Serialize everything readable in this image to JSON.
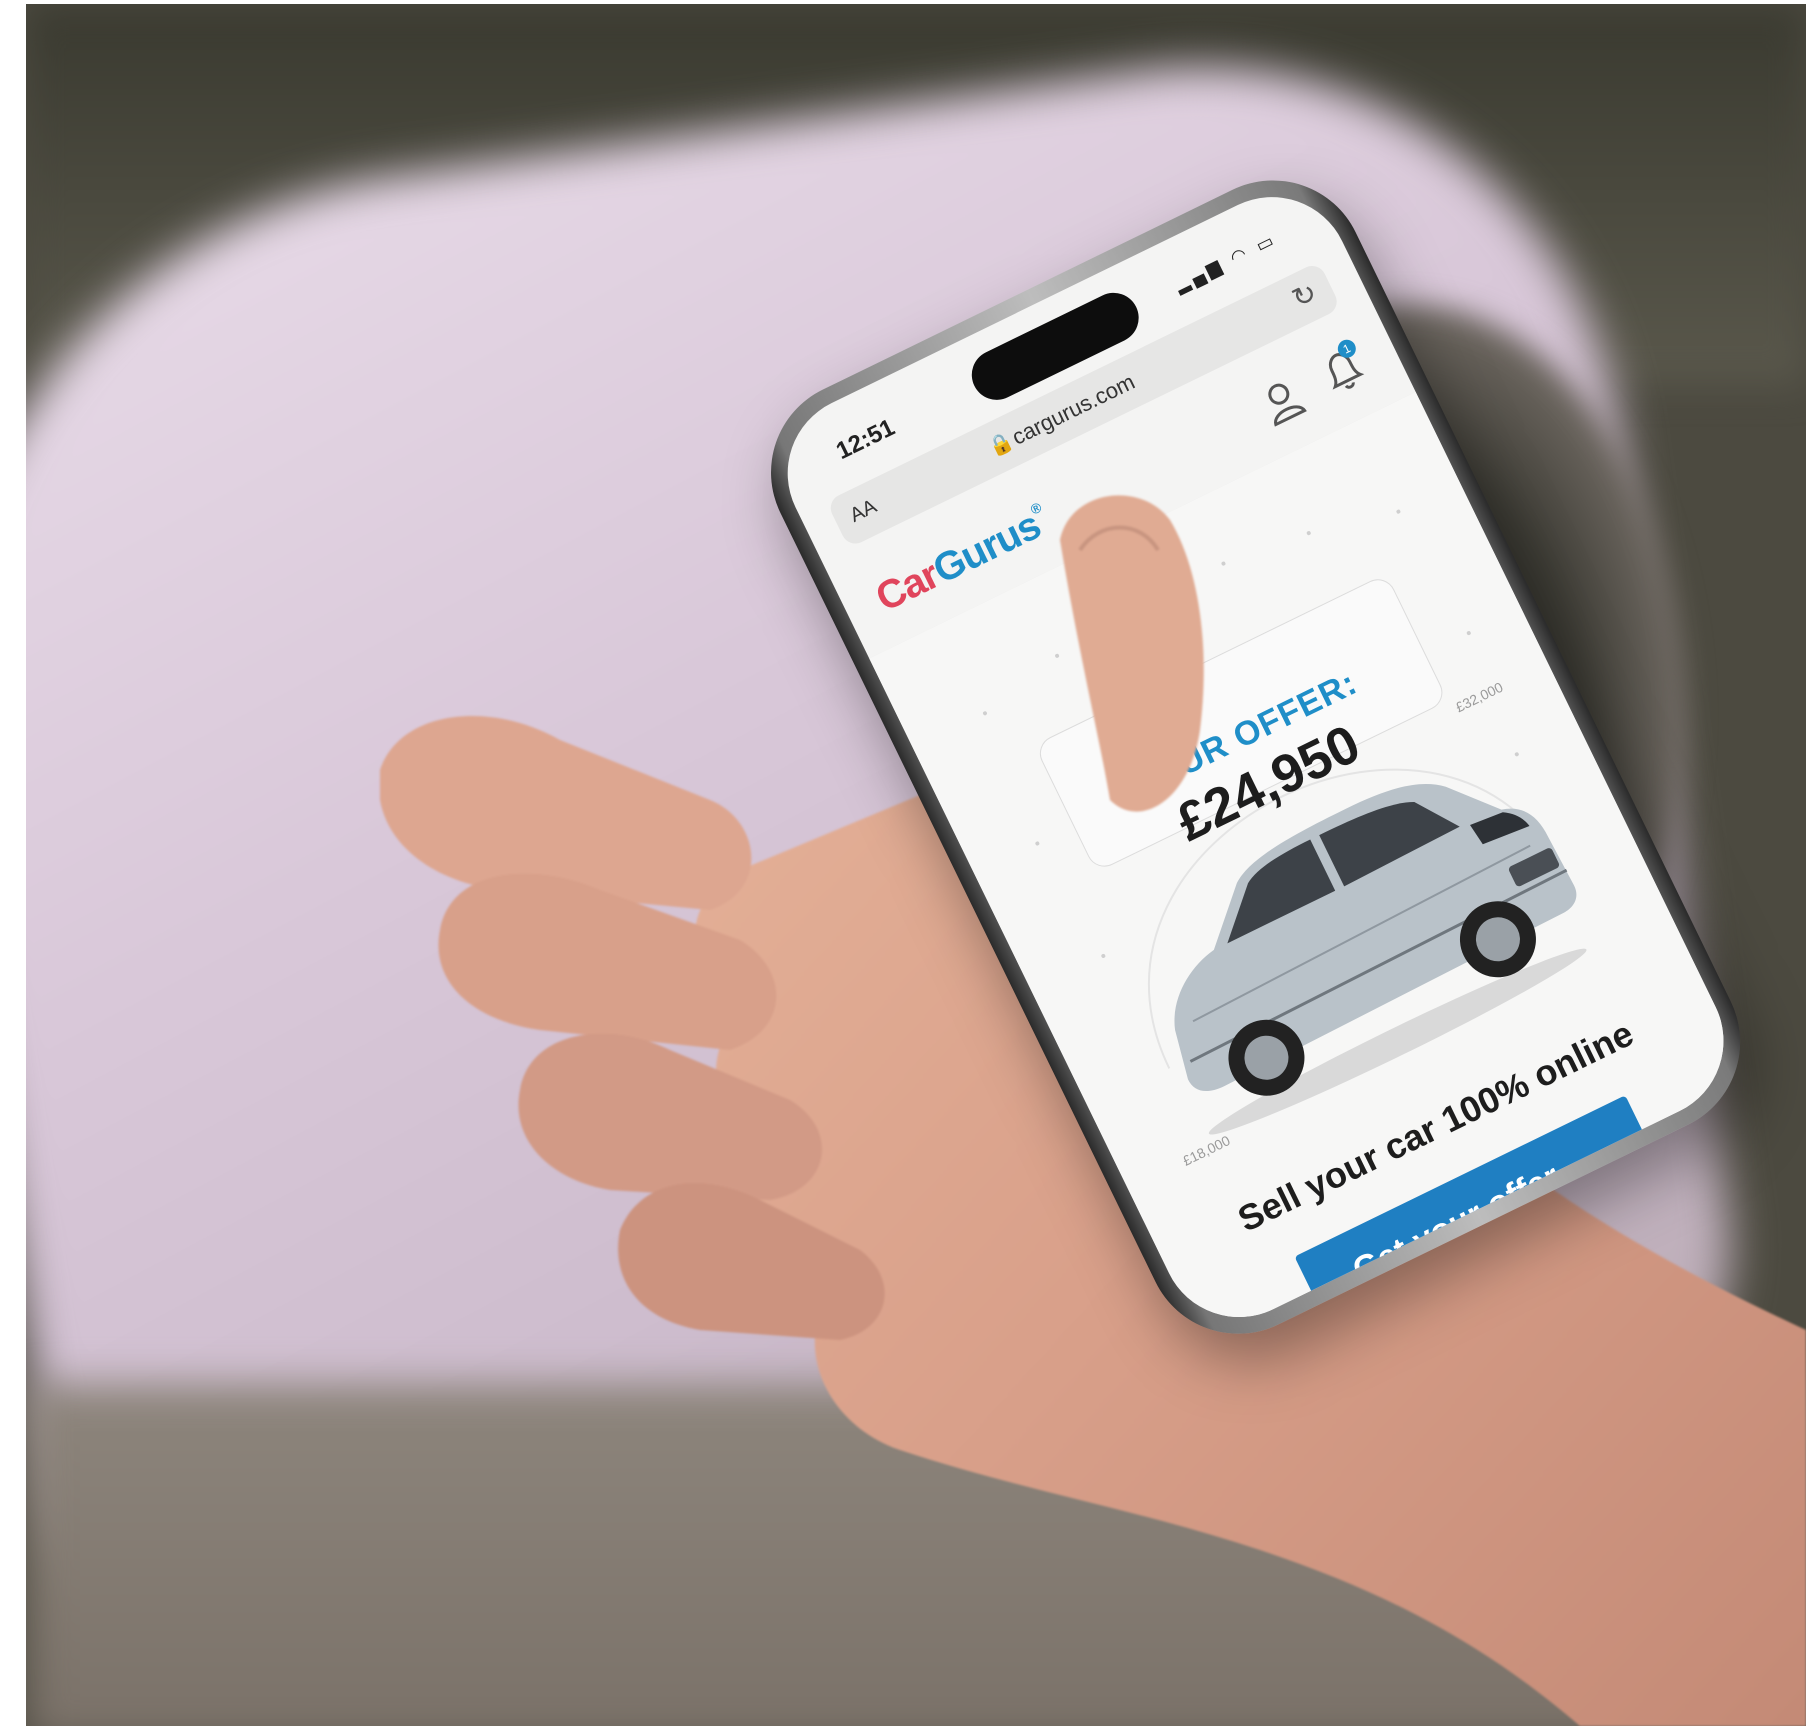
{
  "status_bar": {
    "time": "12:51",
    "icons": "▂▄▆ ◠ ▭"
  },
  "address_bar": {
    "text_size": "AA",
    "lock": "🔒",
    "url": "cargurus.com",
    "reload": "↻"
  },
  "logo": {
    "part1": "Car",
    "part2": "Gurus",
    "mark": "®"
  },
  "header_icons": {
    "bell_badge": "1"
  },
  "hero": {
    "offer_label": "YOUR OFFER:",
    "offer_price": "£24,950",
    "tick_low": "£18,000",
    "tick_high": "£32,000",
    "tagline": "Sell your car 100% online",
    "cta_label": "Get your offer",
    "cta_arrow": "→"
  },
  "colors": {
    "brand_blue": "#1f8ec8",
    "brand_red": "#e0455c",
    "cta_blue": "#1f7fc2"
  }
}
